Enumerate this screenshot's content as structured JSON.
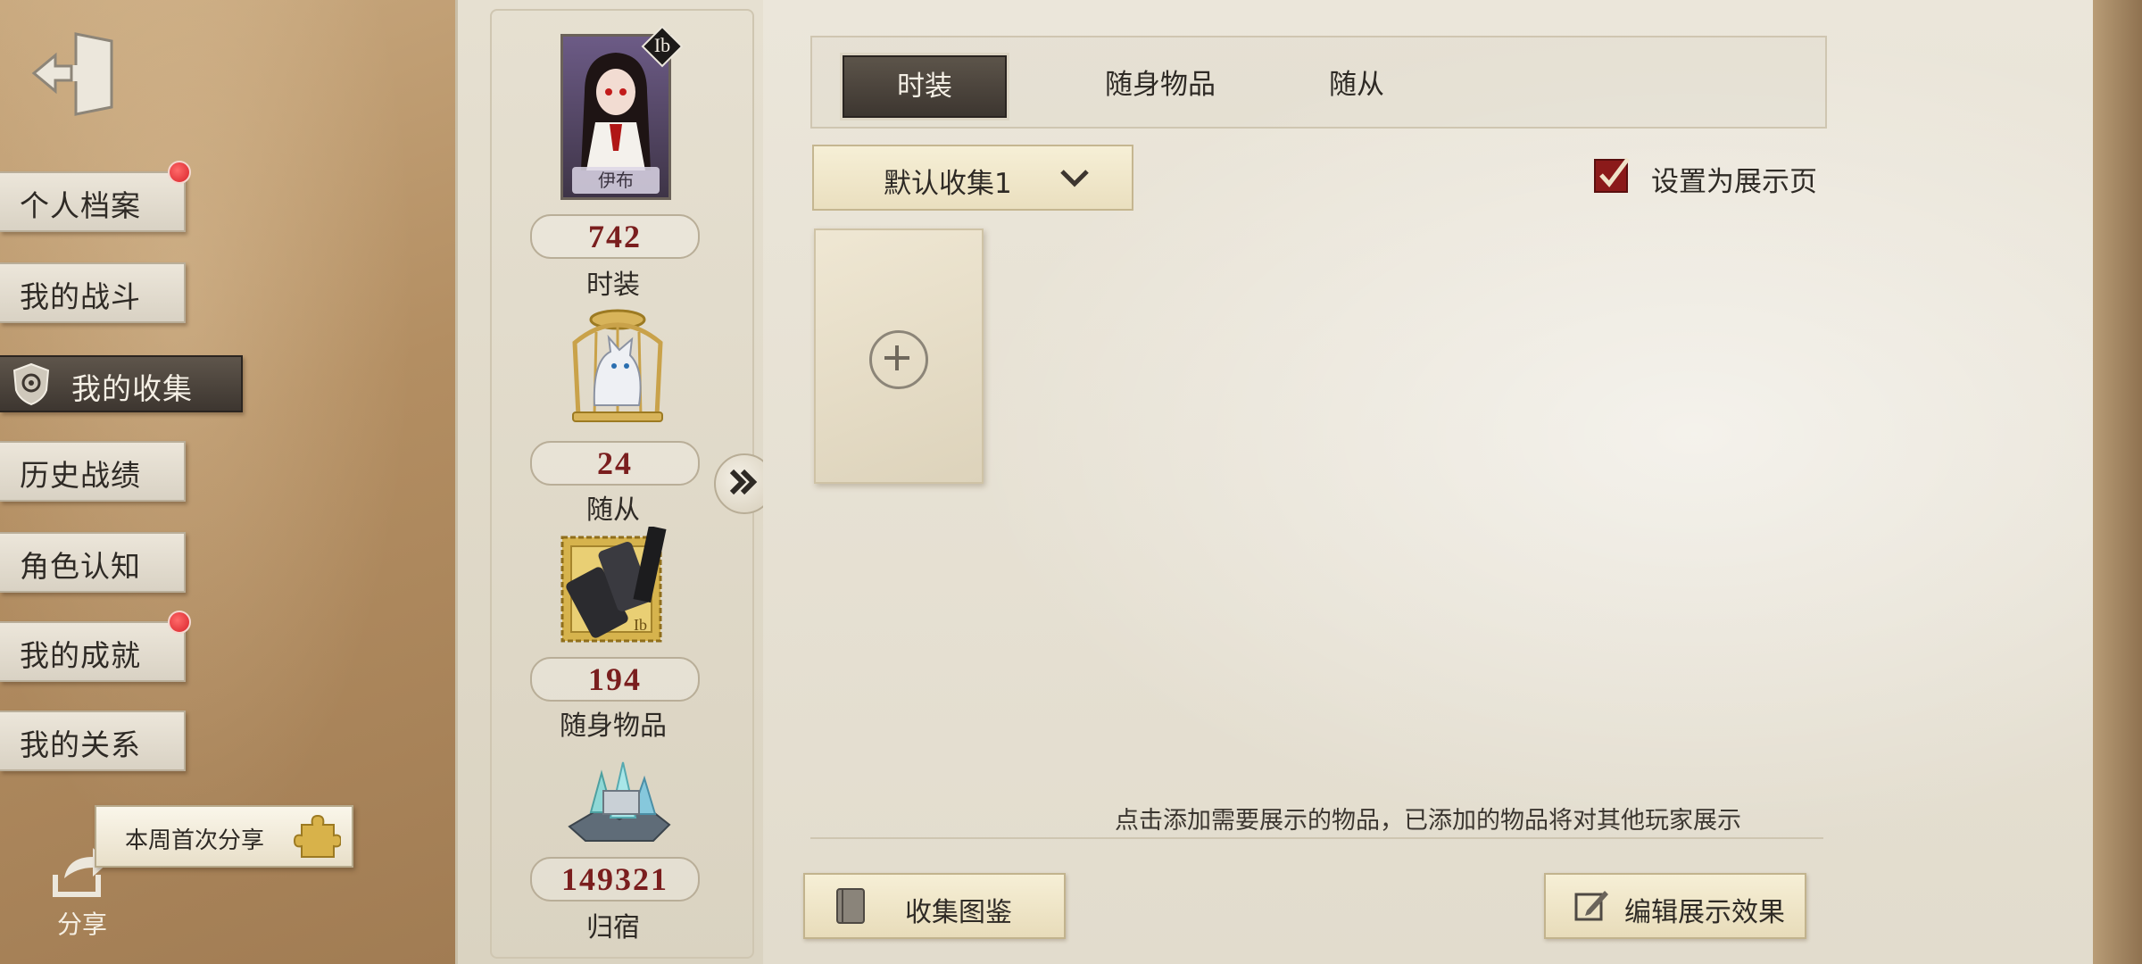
{
  "sidebar": {
    "items": [
      {
        "label": "个人档案",
        "badge": true
      },
      {
        "label": "我的战斗",
        "badge": false
      },
      {
        "label": "我的收集",
        "badge": false,
        "active": true
      },
      {
        "label": "历史战绩",
        "badge": false
      },
      {
        "label": "角色认知",
        "badge": false
      },
      {
        "label": "我的成就",
        "badge": true
      },
      {
        "label": "我的关系",
        "badge": false
      }
    ],
    "share_tip": "本周首次分享",
    "share_label": "分享"
  },
  "stats": {
    "avatar_name": "伊布",
    "avatar_badge": "Ib",
    "items": [
      {
        "value": "742",
        "label": "时装",
        "icon": "costume-portrait"
      },
      {
        "value": "24",
        "label": "随从",
        "icon": "caged-wolf-pet"
      },
      {
        "value": "194",
        "label": "随身物品",
        "icon": "phone-stamp-accessory"
      },
      {
        "value": "149321",
        "label": "归宿",
        "icon": "home-crystal"
      }
    ]
  },
  "tabs": [
    {
      "label": "时装",
      "active": true
    },
    {
      "label": "随身物品",
      "active": false
    },
    {
      "label": "随从",
      "active": false
    }
  ],
  "dropdown": {
    "selected": "默认收集1"
  },
  "showcase_toggle": {
    "label": "设置为展示页",
    "checked": true
  },
  "hint": "点击添加需要展示的物品，已添加的物品将对其他玩家展示",
  "buttons": {
    "collection_guide": "收集图鉴",
    "edit_display": "编辑展示效果"
  },
  "colors": {
    "accent_dark": "#3d3630",
    "stat_red": "#7a1e1e",
    "badge_red": "#d8232a",
    "check_red": "#8b1a1a"
  }
}
